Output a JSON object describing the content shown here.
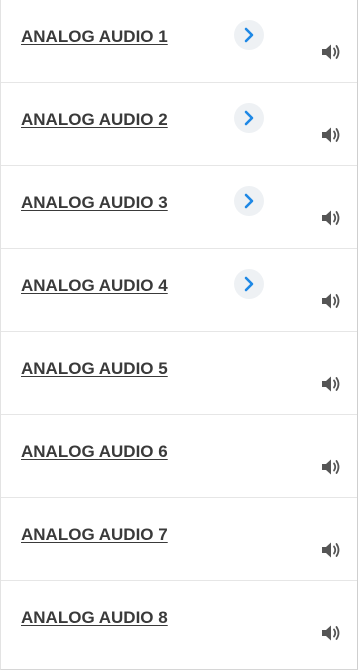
{
  "colors": {
    "label_text": "#3a3a3a",
    "chevron": "#1e88e5",
    "chevron_bg": "#eef1f4",
    "speaker": "#555555"
  },
  "channels": [
    {
      "label": "ANALOG AUDIO 1",
      "has_expand": true,
      "expand_icon": "chevron-right-icon",
      "audio_icon": "speaker-icon"
    },
    {
      "label": "ANALOG AUDIO 2",
      "has_expand": true,
      "expand_icon": "chevron-right-icon",
      "audio_icon": "speaker-icon"
    },
    {
      "label": "ANALOG AUDIO 3",
      "has_expand": true,
      "expand_icon": "chevron-right-icon",
      "audio_icon": "speaker-icon"
    },
    {
      "label": "ANALOG AUDIO 4",
      "has_expand": true,
      "expand_icon": "chevron-right-icon",
      "audio_icon": "speaker-icon"
    },
    {
      "label": "ANALOG AUDIO 5",
      "has_expand": false,
      "audio_icon": "speaker-icon"
    },
    {
      "label": "ANALOG AUDIO 6",
      "has_expand": false,
      "audio_icon": "speaker-icon"
    },
    {
      "label": "ANALOG AUDIO 7",
      "has_expand": false,
      "audio_icon": "speaker-icon"
    },
    {
      "label": "ANALOG AUDIO 8",
      "has_expand": false,
      "audio_icon": "speaker-icon"
    }
  ]
}
